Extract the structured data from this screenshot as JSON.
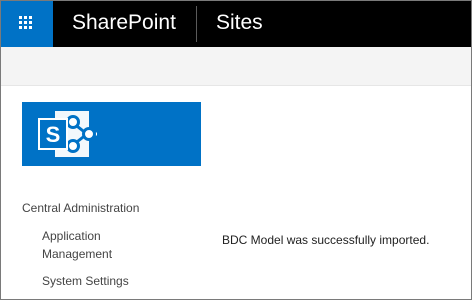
{
  "suite_bar": {
    "app_launcher_icon": "waffle-grid-icon",
    "brand": "SharePoint",
    "sites": "Sites",
    "background": "#000000",
    "launcher_color": "#0072c6"
  },
  "site_logo": {
    "icon": "sharepoint-logo-icon",
    "letter": "S",
    "background": "#0072c6"
  },
  "quick_launch": {
    "heading": "Central Administration",
    "items": [
      {
        "label": "Application Management"
      },
      {
        "label": "System Settings"
      }
    ]
  },
  "main": {
    "message": "BDC Model was successfully imported."
  }
}
